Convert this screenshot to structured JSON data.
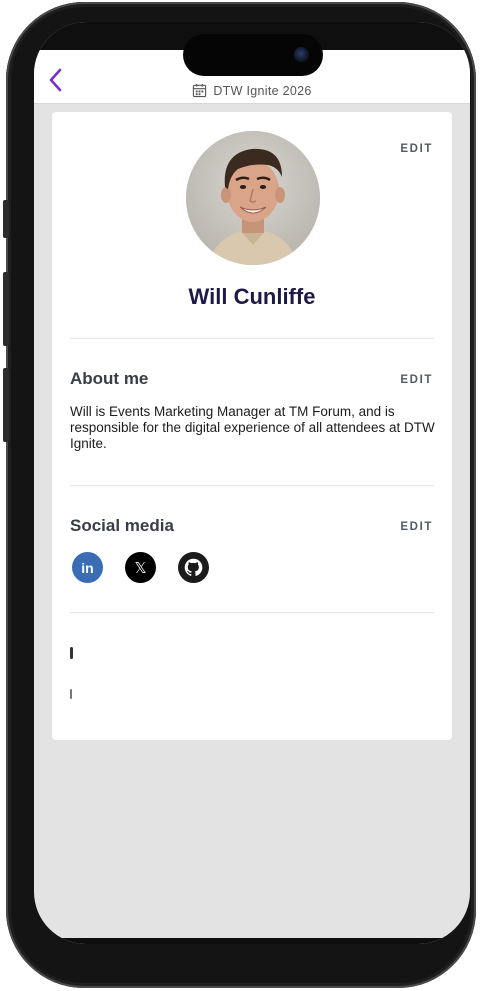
{
  "nav": {
    "back_icon": "chevron-left-icon",
    "event_icon": "calendar-icon",
    "event_title": "DTW Ignite 2026"
  },
  "profile": {
    "name": "Will Cunliffe",
    "edit_label": "EDIT"
  },
  "about": {
    "title": "About me",
    "edit_label": "EDIT",
    "text": "Will is Events Marketing Manager at TM Forum, and is responsible for the digital experience of all attendees at DTW Ignite."
  },
  "social": {
    "title": "Social media",
    "edit_label": "EDIT",
    "links": [
      {
        "icon": "linkedin-icon",
        "label": "in",
        "color": "#3b6db4"
      },
      {
        "icon": "x-icon",
        "label": "𝕏",
        "color": "#000000"
      },
      {
        "icon": "github-icon",
        "label": "",
        "color": "#1b1b1b"
      }
    ]
  },
  "colors": {
    "accent": "#7a2fd0",
    "name": "#1e1a45",
    "screen_bg": "#e3e3e3"
  }
}
